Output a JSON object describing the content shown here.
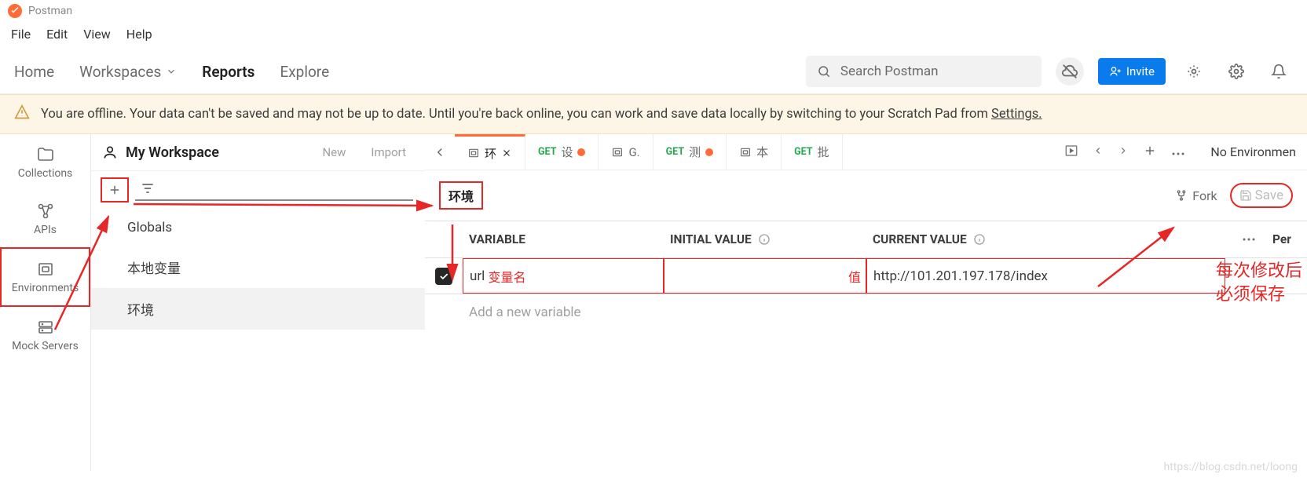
{
  "app": {
    "title": "Postman"
  },
  "menubar": [
    "File",
    "Edit",
    "View",
    "Help"
  ],
  "topnav": {
    "home": "Home",
    "workspaces": "Workspaces",
    "reports": "Reports",
    "explore": "Explore",
    "search_placeholder": "Search Postman",
    "invite": "Invite"
  },
  "banner": {
    "text": "You are offline. Your data can't be saved and may not be up to date. Until you're back online, you can work and save data locally by switching to your Scratch Pad from ",
    "link": "Settings."
  },
  "workspace": {
    "name": "My Workspace",
    "new_btn": "New",
    "import_btn": "Import"
  },
  "icon_col": [
    {
      "key": "collections",
      "label": "Collections"
    },
    {
      "key": "apis",
      "label": "APIs"
    },
    {
      "key": "environments",
      "label": "Environments"
    },
    {
      "key": "mock",
      "label": "Mock Servers"
    }
  ],
  "env_list": [
    {
      "label": "Globals",
      "selected": false
    },
    {
      "label": "本地变量",
      "selected": false
    },
    {
      "label": "环境",
      "selected": true
    }
  ],
  "tabs": [
    {
      "icon": "env",
      "label": "环",
      "active": true,
      "close": true
    },
    {
      "method": "GET",
      "label": "设",
      "dot": true
    },
    {
      "icon": "env",
      "label": "G."
    },
    {
      "method": "GET",
      "label": "测",
      "dot": true
    },
    {
      "icon": "env",
      "label": "本"
    },
    {
      "method": "GET",
      "label": "批"
    }
  ],
  "tabs_right": {
    "no_env": "No Environmen"
  },
  "editor": {
    "env_label": "环境",
    "fork": "Fork",
    "save": "Save"
  },
  "table": {
    "headers": {
      "variable": "VARIABLE",
      "initial": "INITIAL VALUE",
      "current": "CURRENT VALUE",
      "per": "Per"
    },
    "row": {
      "variable": "url",
      "var_note": "变量名",
      "init_note": "值",
      "current": "http://101.201.197.178/index"
    },
    "add_placeholder": "Add a new variable"
  },
  "annotations": {
    "save_note_l1": "每次修改后",
    "save_note_l2": "必须保存"
  },
  "watermark": "https://blog.csdn.net/loong"
}
